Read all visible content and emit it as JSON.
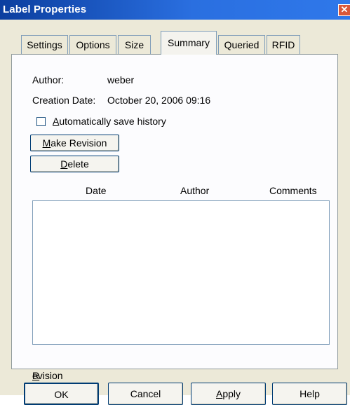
{
  "window": {
    "title": "Label Properties",
    "close_glyph": "✕"
  },
  "tabs": [
    {
      "label": "Settings",
      "active": false
    },
    {
      "label": "Options",
      "active": false
    },
    {
      "label": "Size",
      "active": false
    },
    {
      "label": "Summary",
      "active": true
    },
    {
      "label": "Queried",
      "active": false
    },
    {
      "label": "RFID",
      "active": false
    }
  ],
  "summary": {
    "author_label": "Author:",
    "author_value": "weber",
    "creation_date_label": "Creation Date:",
    "creation_date_value": "October 20, 2006 09:16",
    "auto_save_history": {
      "label_first": "A",
      "label_rest": "utomatically save history",
      "checked": false
    },
    "make_revision": {
      "label_first": "M",
      "label_rest": "ake Revision"
    },
    "delete": {
      "label_first": "D",
      "label_rest": "elete"
    },
    "history_table": {
      "columns": [
        {
          "first": "R",
          "rest": "evision"
        },
        {
          "first": "",
          "rest": "Date"
        },
        {
          "first": "",
          "rest": "Author"
        },
        {
          "first": "",
          "rest": "Comments"
        }
      ],
      "rows": []
    }
  },
  "footer": {
    "ok": "OK",
    "cancel": "Cancel",
    "apply_first": "A",
    "apply_rest": "pply",
    "help": "Help"
  }
}
